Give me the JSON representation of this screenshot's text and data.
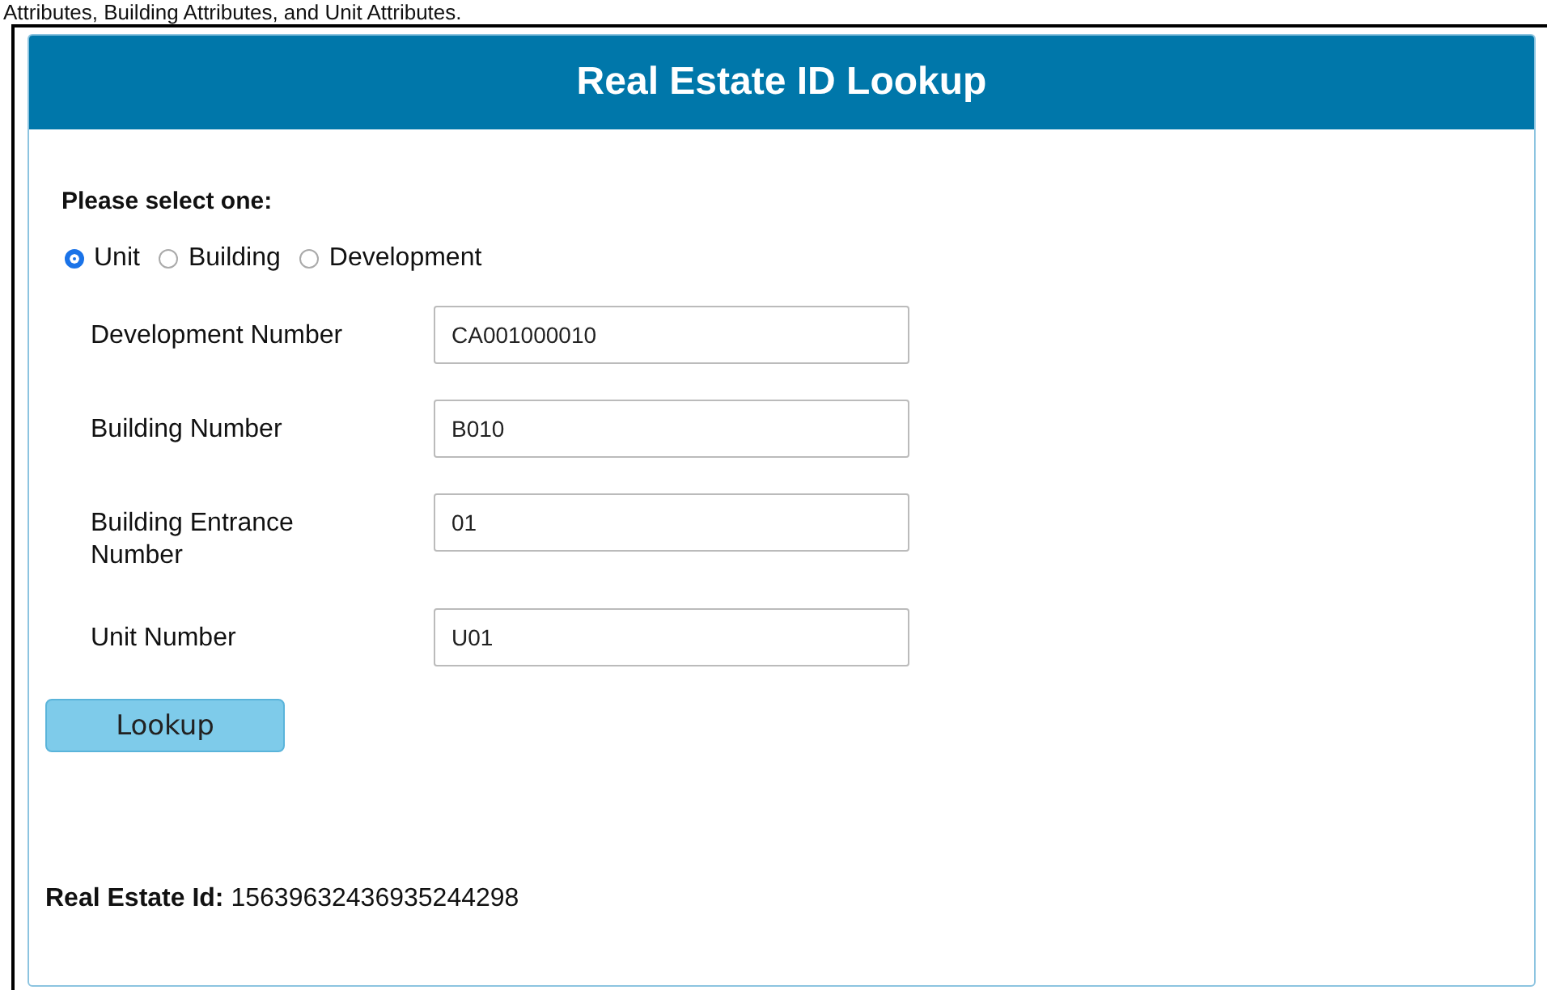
{
  "intro_text": "Attributes, Building Attributes, and Unit Attributes.",
  "panel": {
    "title": "Real Estate ID Lookup"
  },
  "prompt": "Please select one:",
  "options": [
    {
      "label": "Unit",
      "selected": true
    },
    {
      "label": "Building",
      "selected": false
    },
    {
      "label": "Development",
      "selected": false
    }
  ],
  "fields": [
    {
      "label": "Development Number",
      "value": "CA001000010"
    },
    {
      "label": "Building Number",
      "value": "B010"
    },
    {
      "label": "Building Entrance Number",
      "value": "01"
    },
    {
      "label": "Unit Number",
      "value": "U01"
    }
  ],
  "button": "Lookup",
  "result": {
    "label": "Real Estate Id:",
    "value": "15639632436935244298"
  }
}
